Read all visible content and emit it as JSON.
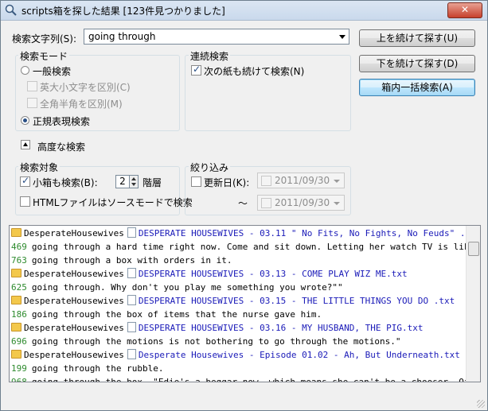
{
  "window": {
    "title": "scripts箱を探した結果 [123件見つかりました]",
    "close_label": "✕"
  },
  "search": {
    "label": "検索文字列(S):",
    "value": "going through"
  },
  "buttons": {
    "next_label": "上を続けて探す(U)",
    "prev_label": "下を続けて探す(D)",
    "all_label": "箱内一括検索(A)"
  },
  "mode": {
    "title": "検索モード",
    "normal_label": "一般検索",
    "case_label": "英大小文字を区別(C)",
    "width_label": "全角半角を区別(M)",
    "regex_label": "正規表現検索"
  },
  "continuous": {
    "title": "連続検索",
    "next_paper_label": "次の紙も続けて検索(N)"
  },
  "advanced": {
    "label": "高度な検索"
  },
  "target": {
    "title": "検索対象",
    "subbox_label": "小箱も検索(B):",
    "depth_value": "2",
    "depth_unit": "階層",
    "html_label": "HTMLファイルはソースモードで検索"
  },
  "filter": {
    "title": "絞り込み",
    "date_label": "更新日(K):",
    "from_date": "2011/09/30",
    "tilde": "～",
    "to_date": "2011/09/30"
  },
  "results": [
    {
      "kind": "file",
      "folder": "DesperateHousewives",
      "file": "DESPERATE HOUSEWIVES - 03.11 \" No Fits,  No Fights,  No Feuds\" .txt"
    },
    {
      "kind": "hit",
      "line": "469",
      "text": "going through a hard time right now. Come and sit down. Letting her watch TV is like me let"
    },
    {
      "kind": "hit",
      "line": "763",
      "text": "going through a box with orders in it."
    },
    {
      "kind": "file",
      "folder": "DesperateHousewives",
      "file": "DESPERATE HOUSEWIVES - 03.13 - COME PLAY WIZ ME.txt"
    },
    {
      "kind": "hit",
      "line": "625",
      "text": "going through. Why don't you play me something you wrote?\"\""
    },
    {
      "kind": "file",
      "folder": "DesperateHousewives",
      "file": "DESPERATE HOUSEWIVES - 03.15 - THE LITTLE THINGS YOU DO .txt"
    },
    {
      "kind": "hit",
      "line": "186",
      "text": "going through the box of items that the nurse gave him."
    },
    {
      "kind": "file",
      "folder": "DesperateHousewives",
      "file": "DESPERATE HOUSEWIVES - 03.16 - MY HUSBAND,  THE PIG.txt"
    },
    {
      "kind": "hit",
      "line": "696",
      "text": "going through the motions is not bothering to go through the motions.\""
    },
    {
      "kind": "file",
      "folder": "DesperateHousewives",
      "file": "Desperate Housewives - Episode 01.02 - Ah, But Underneath.txt"
    },
    {
      "kind": "hit",
      "line": "199",
      "text": "going through the rubble."
    },
    {
      "kind": "hit",
      "line": "968",
      "text": "going through the box. \"Edie's a beggar now, which means she can't be a chooser. Of course"
    }
  ]
}
